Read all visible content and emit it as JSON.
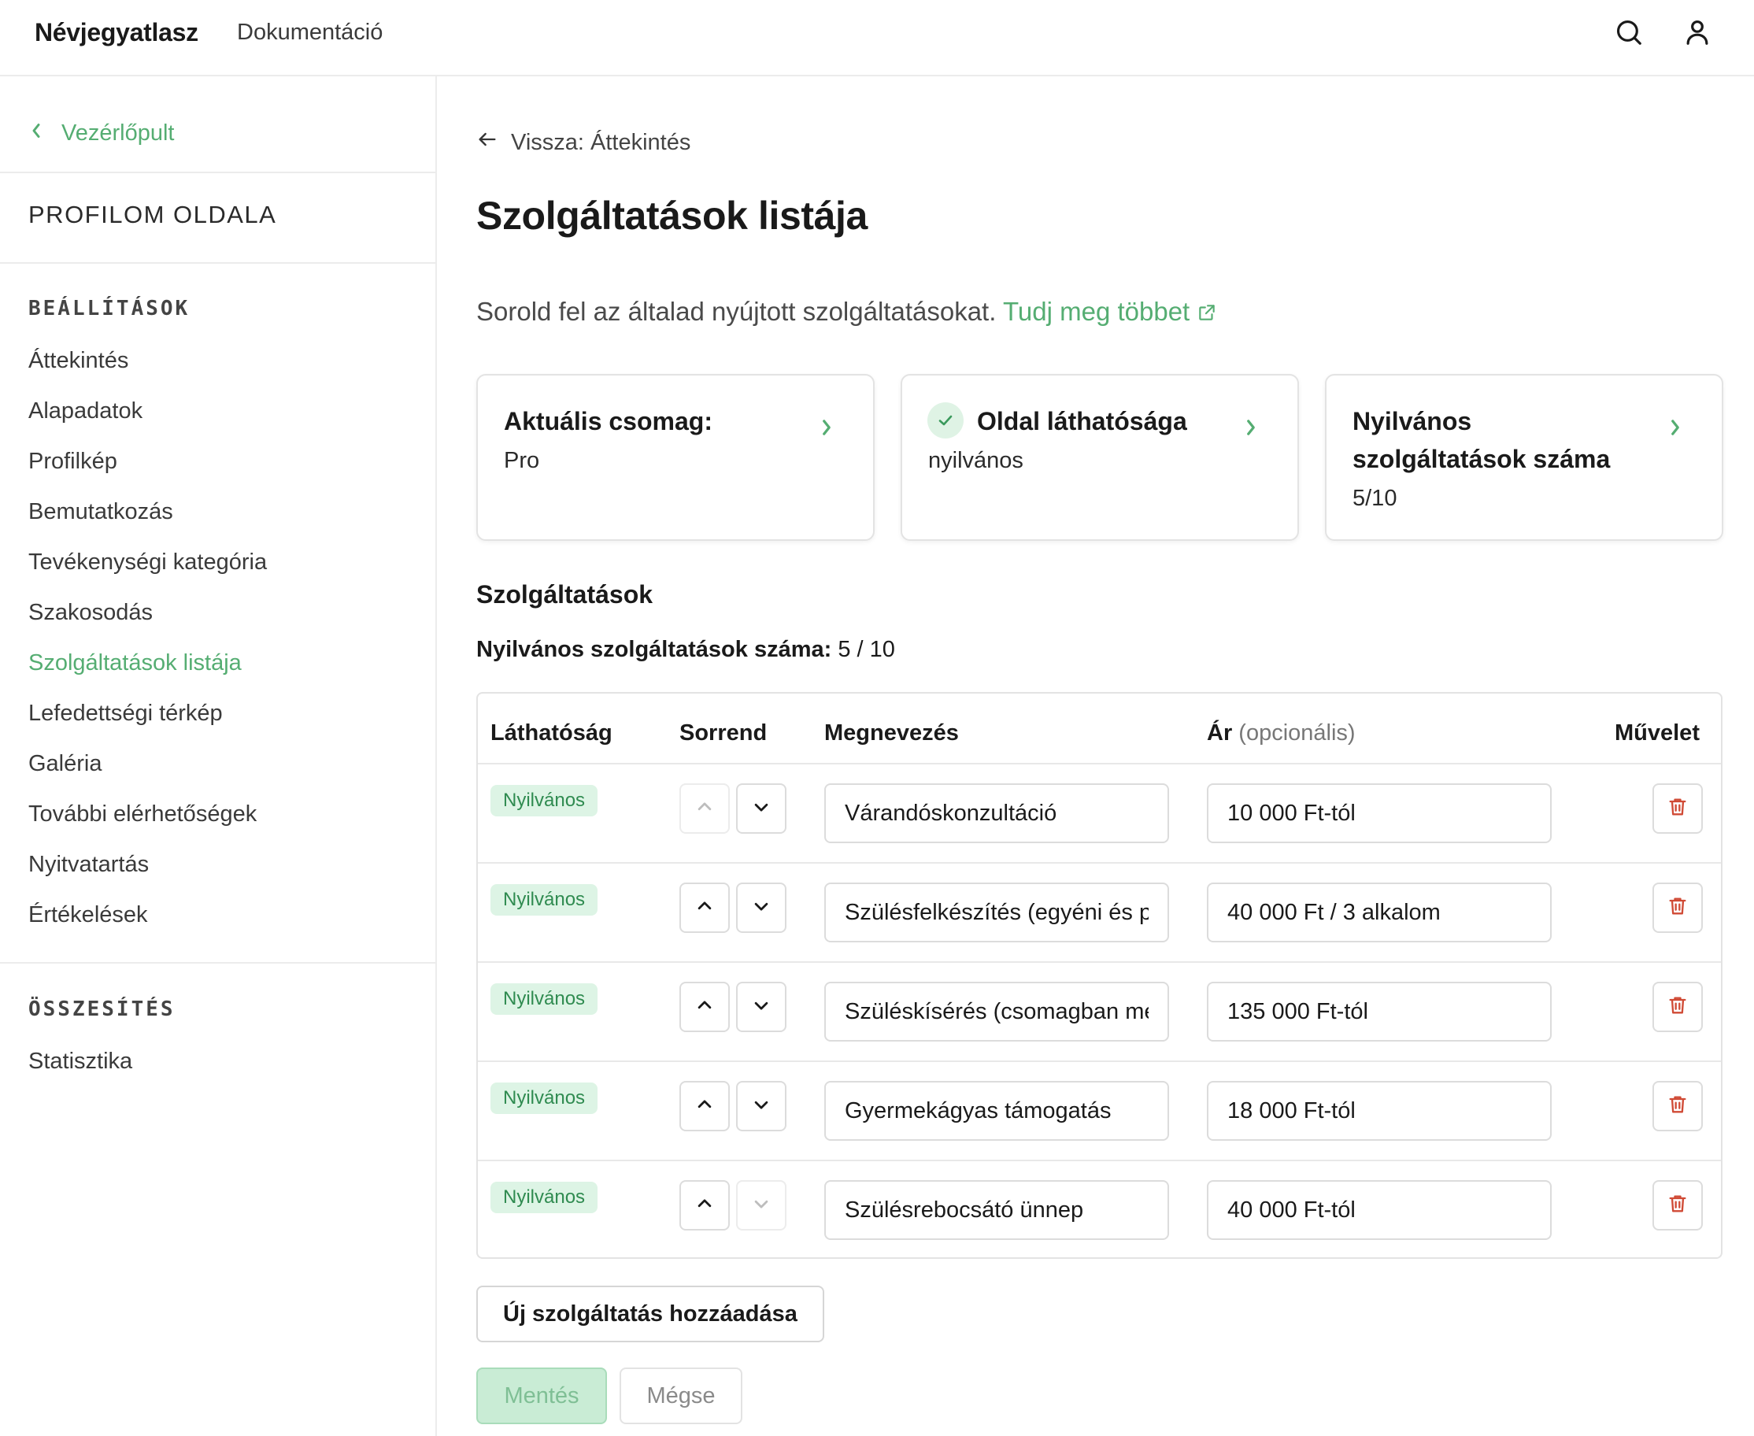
{
  "header": {
    "brand": "Névjegyatlasz",
    "nav_docs": "Dokumentáció",
    "search_icon": "search-icon",
    "user_icon": "user-icon"
  },
  "sidebar": {
    "back_label": "Vezérlőpult",
    "profile_heading": "PROFILOM OLDALA",
    "section_settings": "BEÁLLÍTÁSOK",
    "items": [
      {
        "label": "Áttekintés",
        "active": false
      },
      {
        "label": "Alapadatok",
        "active": false
      },
      {
        "label": "Profilkép",
        "active": false
      },
      {
        "label": "Bemutatkozás",
        "active": false
      },
      {
        "label": "Tevékenységi kategória",
        "active": false
      },
      {
        "label": "Szakosodás",
        "active": false
      },
      {
        "label": "Szolgáltatások listája",
        "active": true
      },
      {
        "label": "Lefedettségi térkép",
        "active": false
      },
      {
        "label": "Galéria",
        "active": false
      },
      {
        "label": "További elérhetőségek",
        "active": false
      },
      {
        "label": "Nyitvatartás",
        "active": false
      },
      {
        "label": "Értékelések",
        "active": false
      }
    ],
    "section_summary": "ÖSSZESÍTÉS",
    "summary_items": [
      {
        "label": "Statisztika"
      }
    ]
  },
  "main": {
    "back_label": "Vissza: Áttekintés",
    "title": "Szolgáltatások listája",
    "intro": "Sorold fel az általad nyújtott szolgáltatásokat.",
    "intro_link": "Tudj meg többet",
    "cards": [
      {
        "title": "Aktuális csomag:",
        "value": "Pro"
      },
      {
        "title": "Oldal láthatósága",
        "value": "nyilvános"
      },
      {
        "title_line1": "Nyilvános",
        "title_line2": "szolgáltatások száma",
        "value": "5/10"
      }
    ],
    "section_title": "Szolgáltatások",
    "count_label": "Nyilvános szolgáltatások száma:",
    "count_value": "5 / 10"
  },
  "table": {
    "headers": {
      "visibility": "Láthatóság",
      "order": "Sorrend",
      "name": "Megnevezés",
      "price": "Ár",
      "price_optional": "(opcionális)",
      "action": "Művelet"
    },
    "rows": [
      {
        "visibility": "Nyilvános",
        "name": "Várandóskonzultáció",
        "price": "10 000 Ft-tól",
        "up_disabled": true,
        "down_disabled": false
      },
      {
        "visibility": "Nyilvános",
        "name": "Szülésfelkészítés (egyéni és páros)",
        "price": "40 000 Ft / 3 alkalom",
        "up_disabled": false,
        "down_disabled": false
      },
      {
        "visibility": "Nyilvános",
        "name": "Szüléskísérés (csomagban megállapodás szerint)",
        "price": "135 000 Ft-tól",
        "up_disabled": false,
        "down_disabled": false
      },
      {
        "visibility": "Nyilvános",
        "name": "Gyermekágyas támogatás",
        "price": "18 000 Ft-tól",
        "up_disabled": false,
        "down_disabled": false
      },
      {
        "visibility": "Nyilvános",
        "name": "Szülésrebocsátó ünnep",
        "price": "40 000 Ft-tól",
        "up_disabled": false,
        "down_disabled": true
      }
    ]
  },
  "actions": {
    "add_label": "Új szolgáltatás hozzáadása",
    "save_label": "Mentés",
    "cancel_label": "Mégse"
  },
  "colors": {
    "accent": "#55ad72",
    "badge_bg": "#ddf4e5",
    "badge_text": "#2f8b50",
    "danger": "#d04a35",
    "border": "#e3e3e3"
  }
}
